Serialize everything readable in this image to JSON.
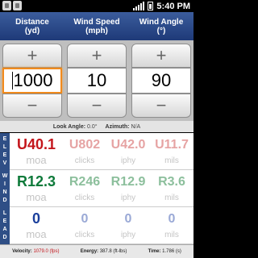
{
  "status_bar": {
    "time": "5:40 PM",
    "notification_icons": [
      "notification-icon",
      "notification-icon"
    ],
    "icons": [
      "signal-icon",
      "battery-icon"
    ]
  },
  "headers": {
    "distance": {
      "line1": "Distance",
      "line2": "(yd)"
    },
    "wind_speed": {
      "line1": "Wind Speed",
      "line2": "(mph)"
    },
    "wind_angle": {
      "line1": "Wind Angle",
      "line2": "(°)"
    }
  },
  "steppers": {
    "distance": {
      "value": "1000",
      "plus": "+",
      "minus": "−"
    },
    "wind_speed": {
      "value": "10",
      "plus": "+",
      "minus": "−"
    },
    "wind_angle": {
      "value": "90",
      "plus": "+",
      "minus": "−"
    }
  },
  "info": {
    "look_angle_label": "Look Angle:",
    "look_angle_value": "0.0°",
    "azimuth_label": "Azimuth:",
    "azimuth_value": "N/A"
  },
  "rows": [
    {
      "side_label": [
        "E",
        "L",
        "E",
        "V"
      ],
      "main": {
        "value": "U40.1",
        "unit": "moa",
        "color": "#c4161c"
      },
      "cells": [
        {
          "value": "U802",
          "unit": "clicks",
          "color": "#e6a3a3"
        },
        {
          "value": "U42.0",
          "unit": "iphy",
          "color": "#e6a3a3"
        },
        {
          "value": "U11.7",
          "unit": "mils",
          "color": "#e6a3a3"
        }
      ]
    },
    {
      "side_label": [
        "W",
        "I",
        "N",
        "D"
      ],
      "main": {
        "value": "R12.3",
        "unit": "moa",
        "color": "#0e7a3a"
      },
      "cells": [
        {
          "value": "R246",
          "unit": "clicks",
          "color": "#8cbf9c"
        },
        {
          "value": "R12.9",
          "unit": "iphy",
          "color": "#8cbf9c"
        },
        {
          "value": "R3.6",
          "unit": "mils",
          "color": "#8cbf9c"
        }
      ]
    },
    {
      "side_label": [
        "L",
        "E",
        "A",
        "D"
      ],
      "main": {
        "value": "0",
        "unit": "moa",
        "color": "#1b3f9c"
      },
      "cells": [
        {
          "value": "0",
          "unit": "clicks",
          "color": "#9aa9d6"
        },
        {
          "value": "0",
          "unit": "iphy",
          "color": "#9aa9d6"
        },
        {
          "value": "0",
          "unit": "mils",
          "color": "#9aa9d6"
        }
      ]
    }
  ],
  "footer": {
    "velocity_label": "Velocity:",
    "velocity_value": "1079.0 (fps)",
    "energy_label": "Energy:",
    "energy_value": "387.8 (ft-lbs)",
    "time_label": "Time:",
    "time_value": "1.786 (s)"
  }
}
